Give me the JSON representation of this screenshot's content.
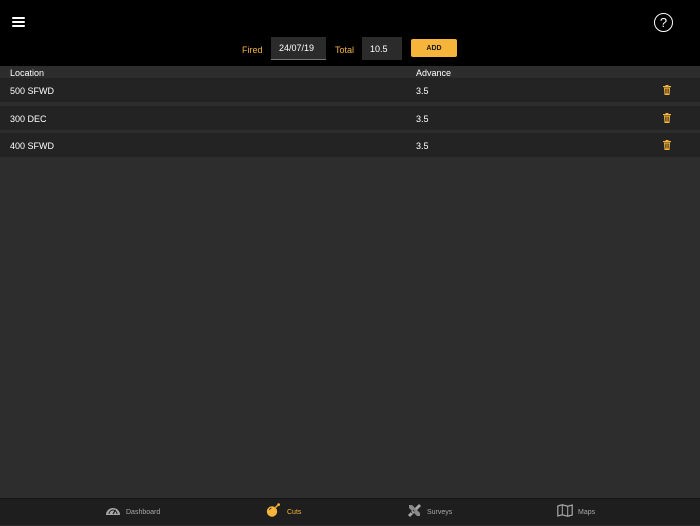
{
  "toolbar": {
    "fired_label": "Fired",
    "fired_value": "24/07/19",
    "total_label": "Total",
    "total_value": "10.5",
    "add_label": "ADD",
    "help_symbol": "?",
    "menu_icon": "hamburger-menu-icon"
  },
  "table": {
    "columns": [
      "Location",
      "Advance"
    ],
    "rows": [
      {
        "location": "500 SFWD",
        "advance": "3.5"
      },
      {
        "location": "300 DEC",
        "advance": "3.5"
      },
      {
        "location": "400 SFWD",
        "advance": "3.5"
      }
    ],
    "row_action_icon": "trash-icon"
  },
  "tabs": [
    {
      "label": "Dashboard",
      "icon": "speedometer-icon",
      "active": false
    },
    {
      "label": "Cuts",
      "icon": "bomb-icon",
      "active": true
    },
    {
      "label": "Surveys",
      "icon": "ruler-pencil-icon",
      "active": false
    },
    {
      "label": "Maps",
      "icon": "map-icon",
      "active": false
    }
  ],
  "colors": {
    "accent": "#f7b43a",
    "background": "#2d2d2d",
    "row": "#232323",
    "topbar": "#000000"
  }
}
